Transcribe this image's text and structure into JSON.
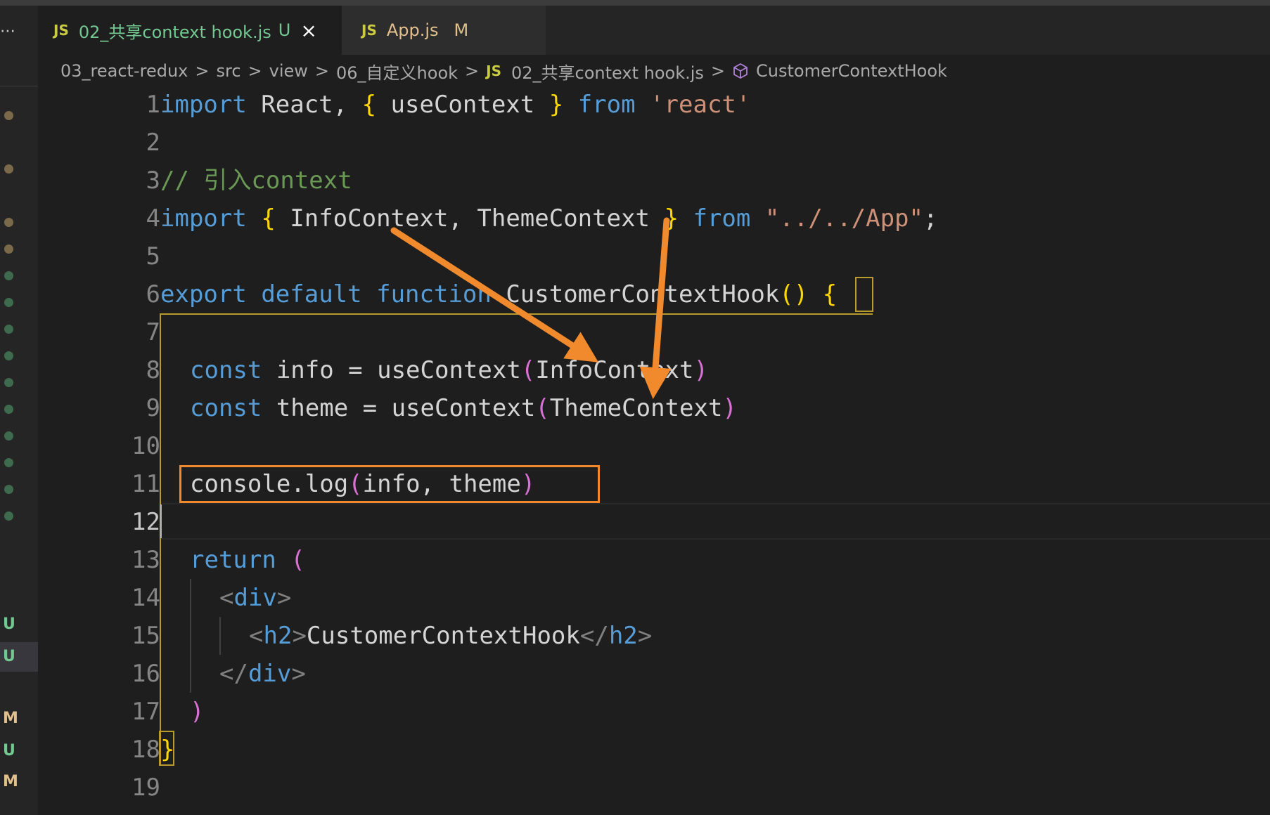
{
  "window": {
    "overflow_menu": "⋯"
  },
  "tabs": [
    {
      "badge": "JS",
      "name": "02_共享context hook.js",
      "status": "U",
      "close": "×",
      "active": true
    },
    {
      "badge": "JS",
      "name": "App.js",
      "status": "M",
      "active": false
    }
  ],
  "breadcrumb": {
    "items": [
      "03_react-redux",
      "src",
      "view",
      "06_自定义hook"
    ],
    "file_badge": "JS",
    "file": "02_共享context hook.js",
    "symbol": "CustomerContextHook",
    "separator": ">"
  },
  "gutter_markers": {
    "letters": [
      "U",
      "U",
      "M",
      "U",
      "M"
    ]
  },
  "editor": {
    "active_line": 12,
    "lines": [
      {
        "n": "1"
      },
      {
        "n": "2"
      },
      {
        "n": "3"
      },
      {
        "n": "4"
      },
      {
        "n": "5"
      },
      {
        "n": "6"
      },
      {
        "n": "7"
      },
      {
        "n": "8"
      },
      {
        "n": "9"
      },
      {
        "n": "10"
      },
      {
        "n": "11"
      },
      {
        "n": "12"
      },
      {
        "n": "13"
      },
      {
        "n": "14"
      },
      {
        "n": "15"
      },
      {
        "n": "16"
      },
      {
        "n": "17"
      },
      {
        "n": "18"
      },
      {
        "n": "19"
      }
    ],
    "tokens": {
      "l1": [
        "import",
        " React, ",
        "{",
        " useContext ",
        "}",
        " ",
        "from",
        " ",
        "'react'"
      ],
      "l3": [
        "// 引入context"
      ],
      "l4": [
        "import",
        " ",
        "{",
        " InfoContext, ThemeContext ",
        "}",
        " ",
        "from",
        " ",
        "\"../../App\"",
        ";"
      ],
      "l6": [
        "export",
        " ",
        "default",
        " ",
        "function",
        " CustomerContextHook",
        "()",
        " ",
        "{"
      ],
      "l8": [
        "const",
        " info = useContext",
        "(",
        "InfoContext",
        ")"
      ],
      "l9": [
        "const",
        " theme = useContext",
        "(",
        "ThemeContext",
        ")"
      ],
      "l11": [
        "console.log",
        "(",
        "info, theme",
        ")"
      ],
      "l13": [
        "return",
        " ",
        "("
      ],
      "l14": [
        "<",
        "div",
        ">"
      ],
      "l15": [
        "<",
        "h2",
        ">",
        "CustomerContextHook",
        "</",
        "h2",
        ">"
      ],
      "l16": [
        "</",
        "div",
        ">"
      ],
      "l17": [
        ")"
      ],
      "l18": [
        "}"
      ]
    }
  },
  "colors": {
    "annotation": "#f08a2d",
    "keyword": "#569cd6",
    "string": "#ce9178",
    "comment": "#6a9955",
    "untracked": "#73c991",
    "modified": "#e2c08d"
  }
}
